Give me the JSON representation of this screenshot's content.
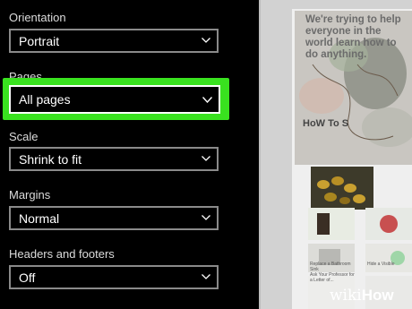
{
  "settings": {
    "orientation": {
      "label": "Orientation",
      "value": "Portrait"
    },
    "pages": {
      "label": "Pages",
      "value": "All pages"
    },
    "scale": {
      "label": "Scale",
      "value": "Shrink to fit"
    },
    "margins": {
      "label": "Margins",
      "value": "Normal"
    },
    "headers_footers": {
      "label": "Headers and footers",
      "value": "Off"
    }
  },
  "preview": {
    "headline": "We're trying to help everyone in the world learn how to do anything.",
    "howto_mark": "HoW To S",
    "small_captions": [
      "Ask Your Professor for a Letter of...",
      "Replace a Bathroom Sink",
      "Hide a Visible"
    ],
    "watermark": {
      "wiki": "wiki",
      "how": "How"
    }
  },
  "colors": {
    "highlight": "#39e21f",
    "panel_bg": "#000000",
    "preview_bg": "#d2d2d2"
  }
}
